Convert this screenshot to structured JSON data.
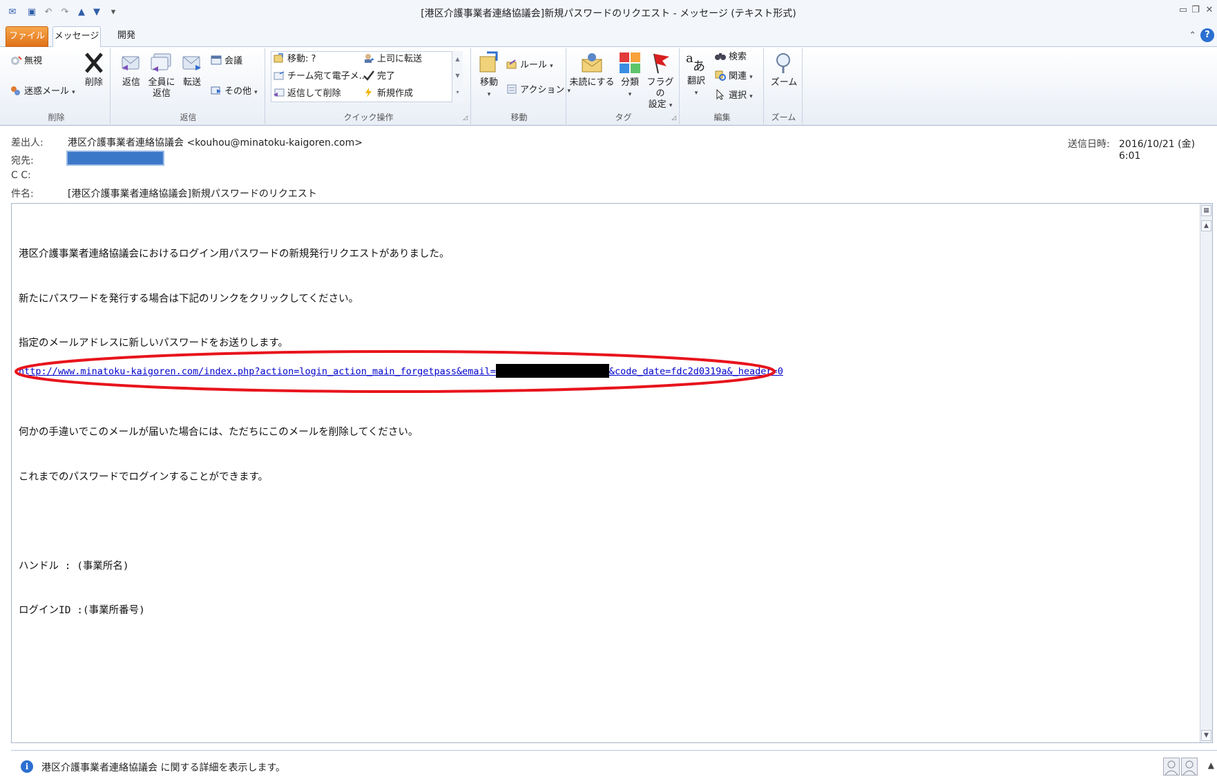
{
  "window": {
    "title": "[港区介護事業者連絡協議会]新規パスワードのリクエスト - メッセージ (テキスト形式)"
  },
  "tabs": {
    "file": "ファイル",
    "message": "メッセージ",
    "developer": "開発"
  },
  "ribbon": {
    "delete_group": {
      "label": "削除",
      "ignore": "無視",
      "junk": "迷惑メール",
      "delete": "削除"
    },
    "respond_group": {
      "label": "返信",
      "reply": "返信",
      "reply_all_1": "全員に",
      "reply_all_2": "返信",
      "forward": "転送",
      "meeting": "会議",
      "more": "その他"
    },
    "quick_steps": {
      "label": "クイック操作",
      "move_to": "移動: ?",
      "team_email": "チーム宛て電子メ...",
      "reply_delete": "返信して削除",
      "to_manager": "上司に転送",
      "done": "完了",
      "create_new": "新規作成"
    },
    "move_group": {
      "label": "移動",
      "move": "移動",
      "rules": "ルール",
      "actions": "アクション"
    },
    "tags_group": {
      "label": "タグ",
      "unread": "未読にする",
      "categorize": "分類",
      "followup_1": "フラグの",
      "followup_2": "設定"
    },
    "editing_group": {
      "label": "編集",
      "translate": "翻訳",
      "find": "検索",
      "related": "関連",
      "select": "選択"
    },
    "zoom_group": {
      "label": "ズーム",
      "zoom": "ズーム"
    }
  },
  "header": {
    "from_label": "差出人:",
    "from_value": "港区介護事業者連絡協議会 <kouhou@minatoku-kaigoren.com>",
    "to_label": "宛先:",
    "cc_label": "C C:",
    "subject_label": "件名:",
    "subject_value": "[港区介護事業者連絡協議会]新規パスワードのリクエスト",
    "sent_label": "送信日時:",
    "sent_value": "2016/10/21 (金) 6:01"
  },
  "body": {
    "line1": "港区介護事業者連絡協議会におけるログイン用パスワードの新規発行リクエストがありました。",
    "line2": "新たにパスワードを発行する場合は下記のリンクをクリックしてください。",
    "line3": "指定のメールアドレスに新しいパスワードをお送りします。",
    "line4": "何かの手違いでこのメールが届いた場合には、ただちにこのメールを削除してください。",
    "line5": "これまでのパスワードでログインすることができます。",
    "line6": "ハンドル : (事業所名)",
    "line7": "ログインID :(事業所番号)",
    "link_part1": "http://www.minatoku-kaigoren.com/index.php?action=login_action_main_forgetpass&email=",
    "link_part2": "&code_date=fdc2d0319a&_header=0"
  },
  "people_pane": {
    "text": "港区介護事業者連絡協議会 に関する詳細を表示します。"
  },
  "colors": {
    "highlight_ellipse": "#e8141c",
    "link": "#0000cc",
    "file_tab": "#e8801f"
  }
}
